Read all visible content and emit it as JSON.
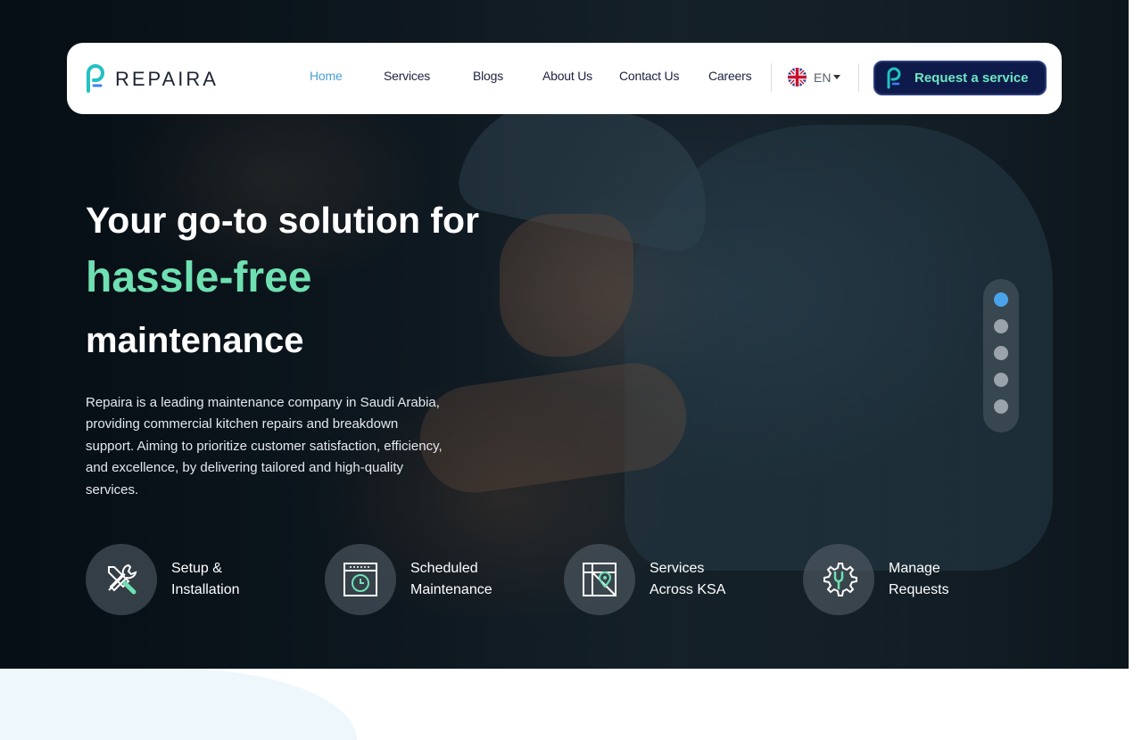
{
  "header": {
    "brand": "REPAIRA",
    "nav": [
      {
        "label": "Home",
        "active": true
      },
      {
        "label": "Services",
        "active": false
      },
      {
        "label": "Blogs",
        "active": false
      },
      {
        "label": "About Us",
        "active": false
      },
      {
        "label": "Contact Us",
        "active": false
      },
      {
        "label": "Careers",
        "active": false
      }
    ],
    "language": "EN",
    "cta_label": "Request a service"
  },
  "hero": {
    "title_line1": "Your go-to solution for",
    "title_highlight": "hassle-free",
    "title_line3": "maintenance",
    "description": "Repaira is a leading maintenance company in Saudi Arabia, providing commercial kitchen repairs and breakdown support. Aiming to prioritize customer satisfaction, efficiency, and excellence, by delivering tailored and high-quality services.",
    "slider": {
      "total": 5,
      "active_index": 0
    }
  },
  "features": [
    {
      "icon": "tools-icon",
      "line1": "Setup &",
      "line2": "Installation"
    },
    {
      "icon": "clock-calendar-icon",
      "line1": "Scheduled",
      "line2": "Maintenance"
    },
    {
      "icon": "map-pin-icon",
      "line1": "Services",
      "line2": "Across KSA"
    },
    {
      "icon": "gear-wrench-icon",
      "line1": "Manage",
      "line2": "Requests"
    }
  ],
  "colors": {
    "brand_navy": "#0e1b4a",
    "accent_green": "#6fe0b2",
    "nav_active": "#4a9fd6",
    "logo_teal": "#22c1c3"
  }
}
